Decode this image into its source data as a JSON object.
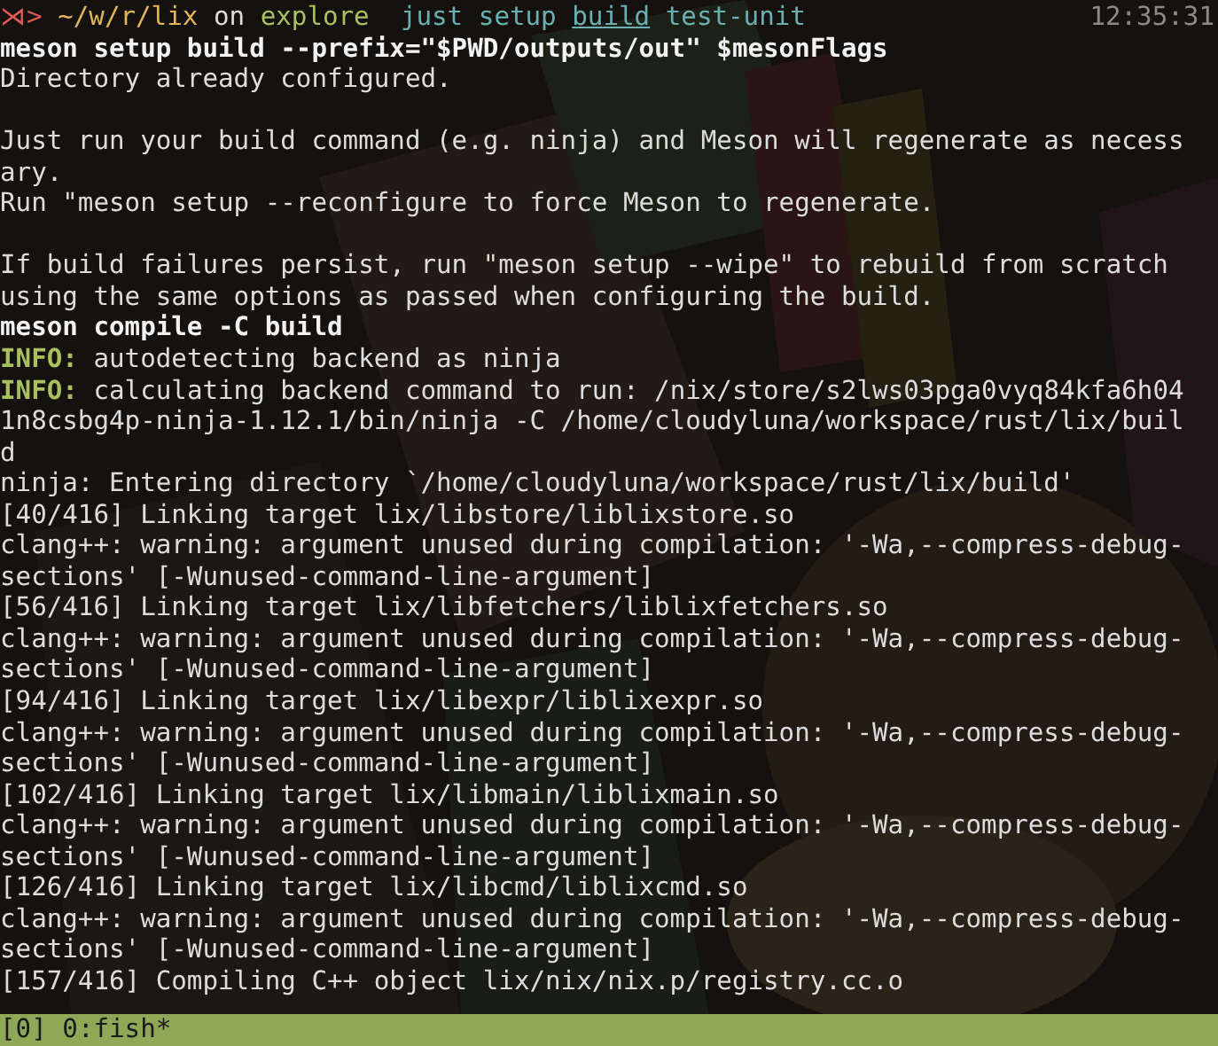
{
  "prompt": {
    "symbol": "⋊>",
    "path": "~/w/r/lix",
    "on": "on",
    "branch": "explore",
    "recipes": [
      {
        "name": "just",
        "underlined": false
      },
      {
        "name": "setup",
        "underlined": false
      },
      {
        "name": "build",
        "underlined": true
      },
      {
        "name": "test-unit",
        "underlined": false
      }
    ],
    "time": "12:35:31"
  },
  "lines": [
    {
      "kind": "command",
      "text": "meson setup build --prefix=\"$PWD/outputs/out\" $mesonFlags"
    },
    {
      "kind": "output",
      "text": "Directory already configured."
    },
    {
      "kind": "blank"
    },
    {
      "kind": "output",
      "text": "Just run your build command (e.g. ninja) and Meson will regenerate as necess"
    },
    {
      "kind": "output",
      "text": "ary."
    },
    {
      "kind": "output",
      "text": "Run \"meson setup --reconfigure to force Meson to regenerate."
    },
    {
      "kind": "blank"
    },
    {
      "kind": "output",
      "text": "If build failures persist, run \"meson setup --wipe\" to rebuild from scratch"
    },
    {
      "kind": "output",
      "text": "using the same options as passed when configuring the build."
    },
    {
      "kind": "command",
      "text": "meson compile -C build"
    },
    {
      "kind": "info",
      "tag": "INFO:",
      "text": "autodetecting backend as ninja"
    },
    {
      "kind": "info",
      "tag": "INFO:",
      "text": "calculating backend command to run: /nix/store/s2lws03pga0vyq84kfa6h04"
    },
    {
      "kind": "output",
      "text": "1n8csbg4p-ninja-1.12.1/bin/ninja -C /home/cloudyluna/workspace/rust/lix/buil"
    },
    {
      "kind": "output",
      "text": "d"
    },
    {
      "kind": "output",
      "text": "ninja: Entering directory `/home/cloudyluna/workspace/rust/lix/build'"
    },
    {
      "kind": "output",
      "text": "[40/416] Linking target lix/libstore/liblixstore.so"
    },
    {
      "kind": "output",
      "text": "clang++: warning: argument unused during compilation: '-Wa,--compress-debug-"
    },
    {
      "kind": "output",
      "text": "sections' [-Wunused-command-line-argument]"
    },
    {
      "kind": "output",
      "text": "[56/416] Linking target lix/libfetchers/liblixfetchers.so"
    },
    {
      "kind": "output",
      "text": "clang++: warning: argument unused during compilation: '-Wa,--compress-debug-"
    },
    {
      "kind": "output",
      "text": "sections' [-Wunused-command-line-argument]"
    },
    {
      "kind": "output",
      "text": "[94/416] Linking target lix/libexpr/liblixexpr.so"
    },
    {
      "kind": "output",
      "text": "clang++: warning: argument unused during compilation: '-Wa,--compress-debug-"
    },
    {
      "kind": "output",
      "text": "sections' [-Wunused-command-line-argument]"
    },
    {
      "kind": "output",
      "text": "[102/416] Linking target lix/libmain/liblixmain.so"
    },
    {
      "kind": "output",
      "text": "clang++: warning: argument unused during compilation: '-Wa,--compress-debug-"
    },
    {
      "kind": "output",
      "text": "sections' [-Wunused-command-line-argument]"
    },
    {
      "kind": "output",
      "text": "[126/416] Linking target lix/libcmd/liblixcmd.so"
    },
    {
      "kind": "output",
      "text": "clang++: warning: argument unused during compilation: '-Wa,--compress-debug-"
    },
    {
      "kind": "output",
      "text": "sections' [-Wunused-command-line-argument]"
    },
    {
      "kind": "output",
      "text": "[157/416] Compiling C++ object lix/nix/nix.p/registry.cc.o"
    }
  ],
  "status_bar": {
    "session": "[0]",
    "window": "0:fish*"
  }
}
